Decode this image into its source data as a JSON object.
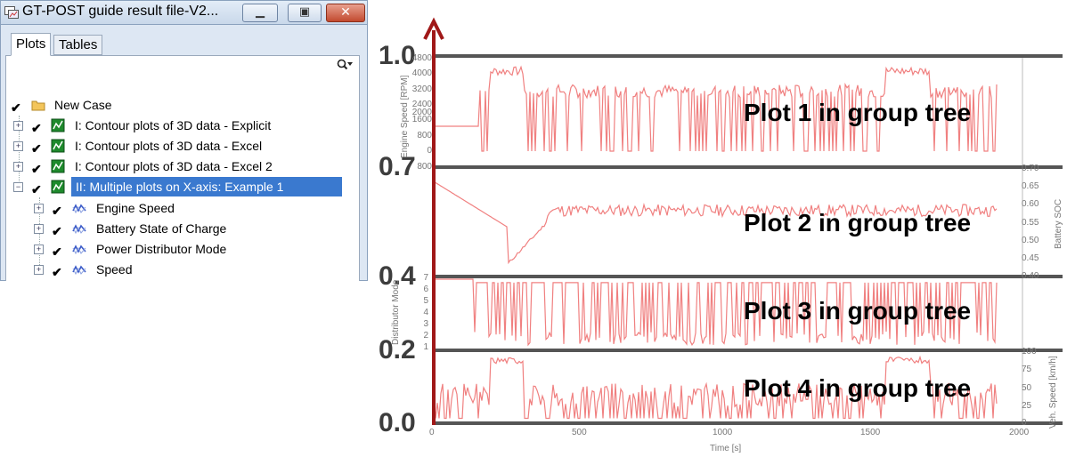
{
  "window": {
    "title": "GT-POST guide result file-V2...",
    "min_glyph": "▁",
    "max_glyph": "▣",
    "close_glyph": "✕"
  },
  "tabs": [
    {
      "label": "Plots",
      "active": true
    },
    {
      "label": "Tables",
      "active": false
    }
  ],
  "tree": {
    "root_label": "New Case",
    "items": [
      {
        "label": "I: Contour plots of 3D data - Explicit",
        "checked": true
      },
      {
        "label": "I: Contour plots of 3D data - Excel",
        "checked": true
      },
      {
        "label": "I: Contour plots of 3D data - Excel 2",
        "checked": true
      },
      {
        "label": "II: Multiple plots on X-axis: Example 1",
        "checked": true,
        "selected": true
      }
    ],
    "children": [
      {
        "label": "Engine Speed"
      },
      {
        "label": "Battery State of Charge"
      },
      {
        "label": "Power Distributor Mode"
      },
      {
        "label": "Speed"
      }
    ],
    "check_glyph": "✔",
    "expand_glyph": "+",
    "collapse_glyph": "−"
  },
  "chart": {
    "levels": [
      "1.0",
      "0.7",
      "0.4",
      "0.2",
      "0.0"
    ],
    "plot_labels": [
      "Plot 1 in group tree",
      "Plot 2 in group tree",
      "Plot 3 in group tree",
      "Plot 4 in group tree"
    ],
    "plot1": {
      "ylabel": "Engine Speed [RPM]",
      "ticks": [
        "4800",
        "4000",
        "3200",
        "2400",
        "2000",
        "1600",
        "800",
        "0"
      ]
    },
    "plot2": {
      "ylabel": "Battery SOC",
      "ticks": [
        "0.70",
        "0.65",
        "0.60",
        "0.55",
        "0.50",
        "0.45",
        "0.40"
      ]
    },
    "plot3": {
      "ylabel": "Distributor Mode",
      "ticks": [
        "7",
        "6",
        "5",
        "4",
        "3",
        "2",
        "1"
      ]
    },
    "plot4": {
      "ylabel": "Veh. Speed [km/h]",
      "ticks": [
        "100",
        "75",
        "50",
        "25",
        "0"
      ]
    },
    "top_tick": "800",
    "xaxis": {
      "label": "Time [s]",
      "ticks": [
        "0",
        "500",
        "1000",
        "1500",
        "2000"
      ]
    },
    "colors": {
      "series": "#f08080",
      "axis_arrow": "#a01818",
      "divider": "#555555"
    }
  }
}
